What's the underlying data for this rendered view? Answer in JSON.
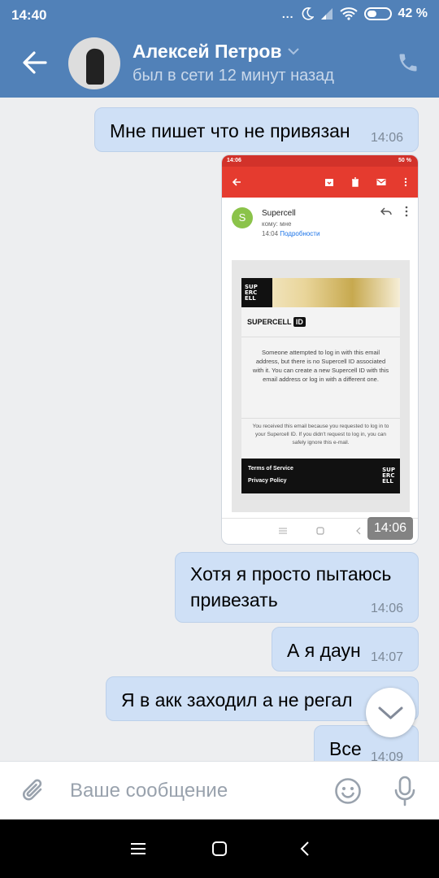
{
  "status_bar": {
    "time": "14:40",
    "dots": "...",
    "battery": "42 %",
    "battery_level": 0.42
  },
  "header": {
    "contact_name": "Алексей Петров",
    "contact_status": "был в сети 12 минут назад"
  },
  "messages": [
    {
      "text": "Мне пишет что не привязан",
      "time": "14:06"
    },
    {
      "text": "Хотя я просто пытаюсь\nпривезать",
      "time": "14:06"
    },
    {
      "text": "А я даун",
      "time": "14:07"
    },
    {
      "text": "Я в акк заходил а не регал",
      "time": ""
    },
    {
      "text": "Все",
      "time": "14:09"
    }
  ],
  "attachment": {
    "time": "14:06",
    "screenshot": {
      "status_time": "14:06",
      "status_battery": "50 %",
      "sender_initial": "S",
      "sender": "Supercell",
      "to": "кому: мне",
      "sent_time": "14:04",
      "details_link": "Подробности",
      "logo_text": "SUP\nERC\nELL",
      "brand": "SUPERCELL",
      "brand_badge": "ID",
      "body": "Someone attempted to log in with this email address, but there is no Supercell ID associated with it. You can create a new Supercell ID with this email address or log in with a different one.",
      "note": "You received this email because you requested to log in to your Supercell ID. If you didn't request to log in, you can safely ignore this e-mail.",
      "footer_terms": "Terms of Service",
      "footer_privacy": "Privacy Policy"
    }
  },
  "composer": {
    "placeholder": "Ваше сообщение"
  },
  "icons": {
    "back": "arrow-left-icon",
    "dropdown": "chevron-down-icon",
    "call": "phone-icon",
    "attach": "paperclip-icon",
    "emoji": "smile-icon",
    "mic": "microphone-icon",
    "scroll": "chevron-down-icon"
  },
  "colors": {
    "header": "#5181b8",
    "bubble": "#cfe0f6",
    "background": "#edeef0",
    "gmail_red": "#e53b2f"
  }
}
